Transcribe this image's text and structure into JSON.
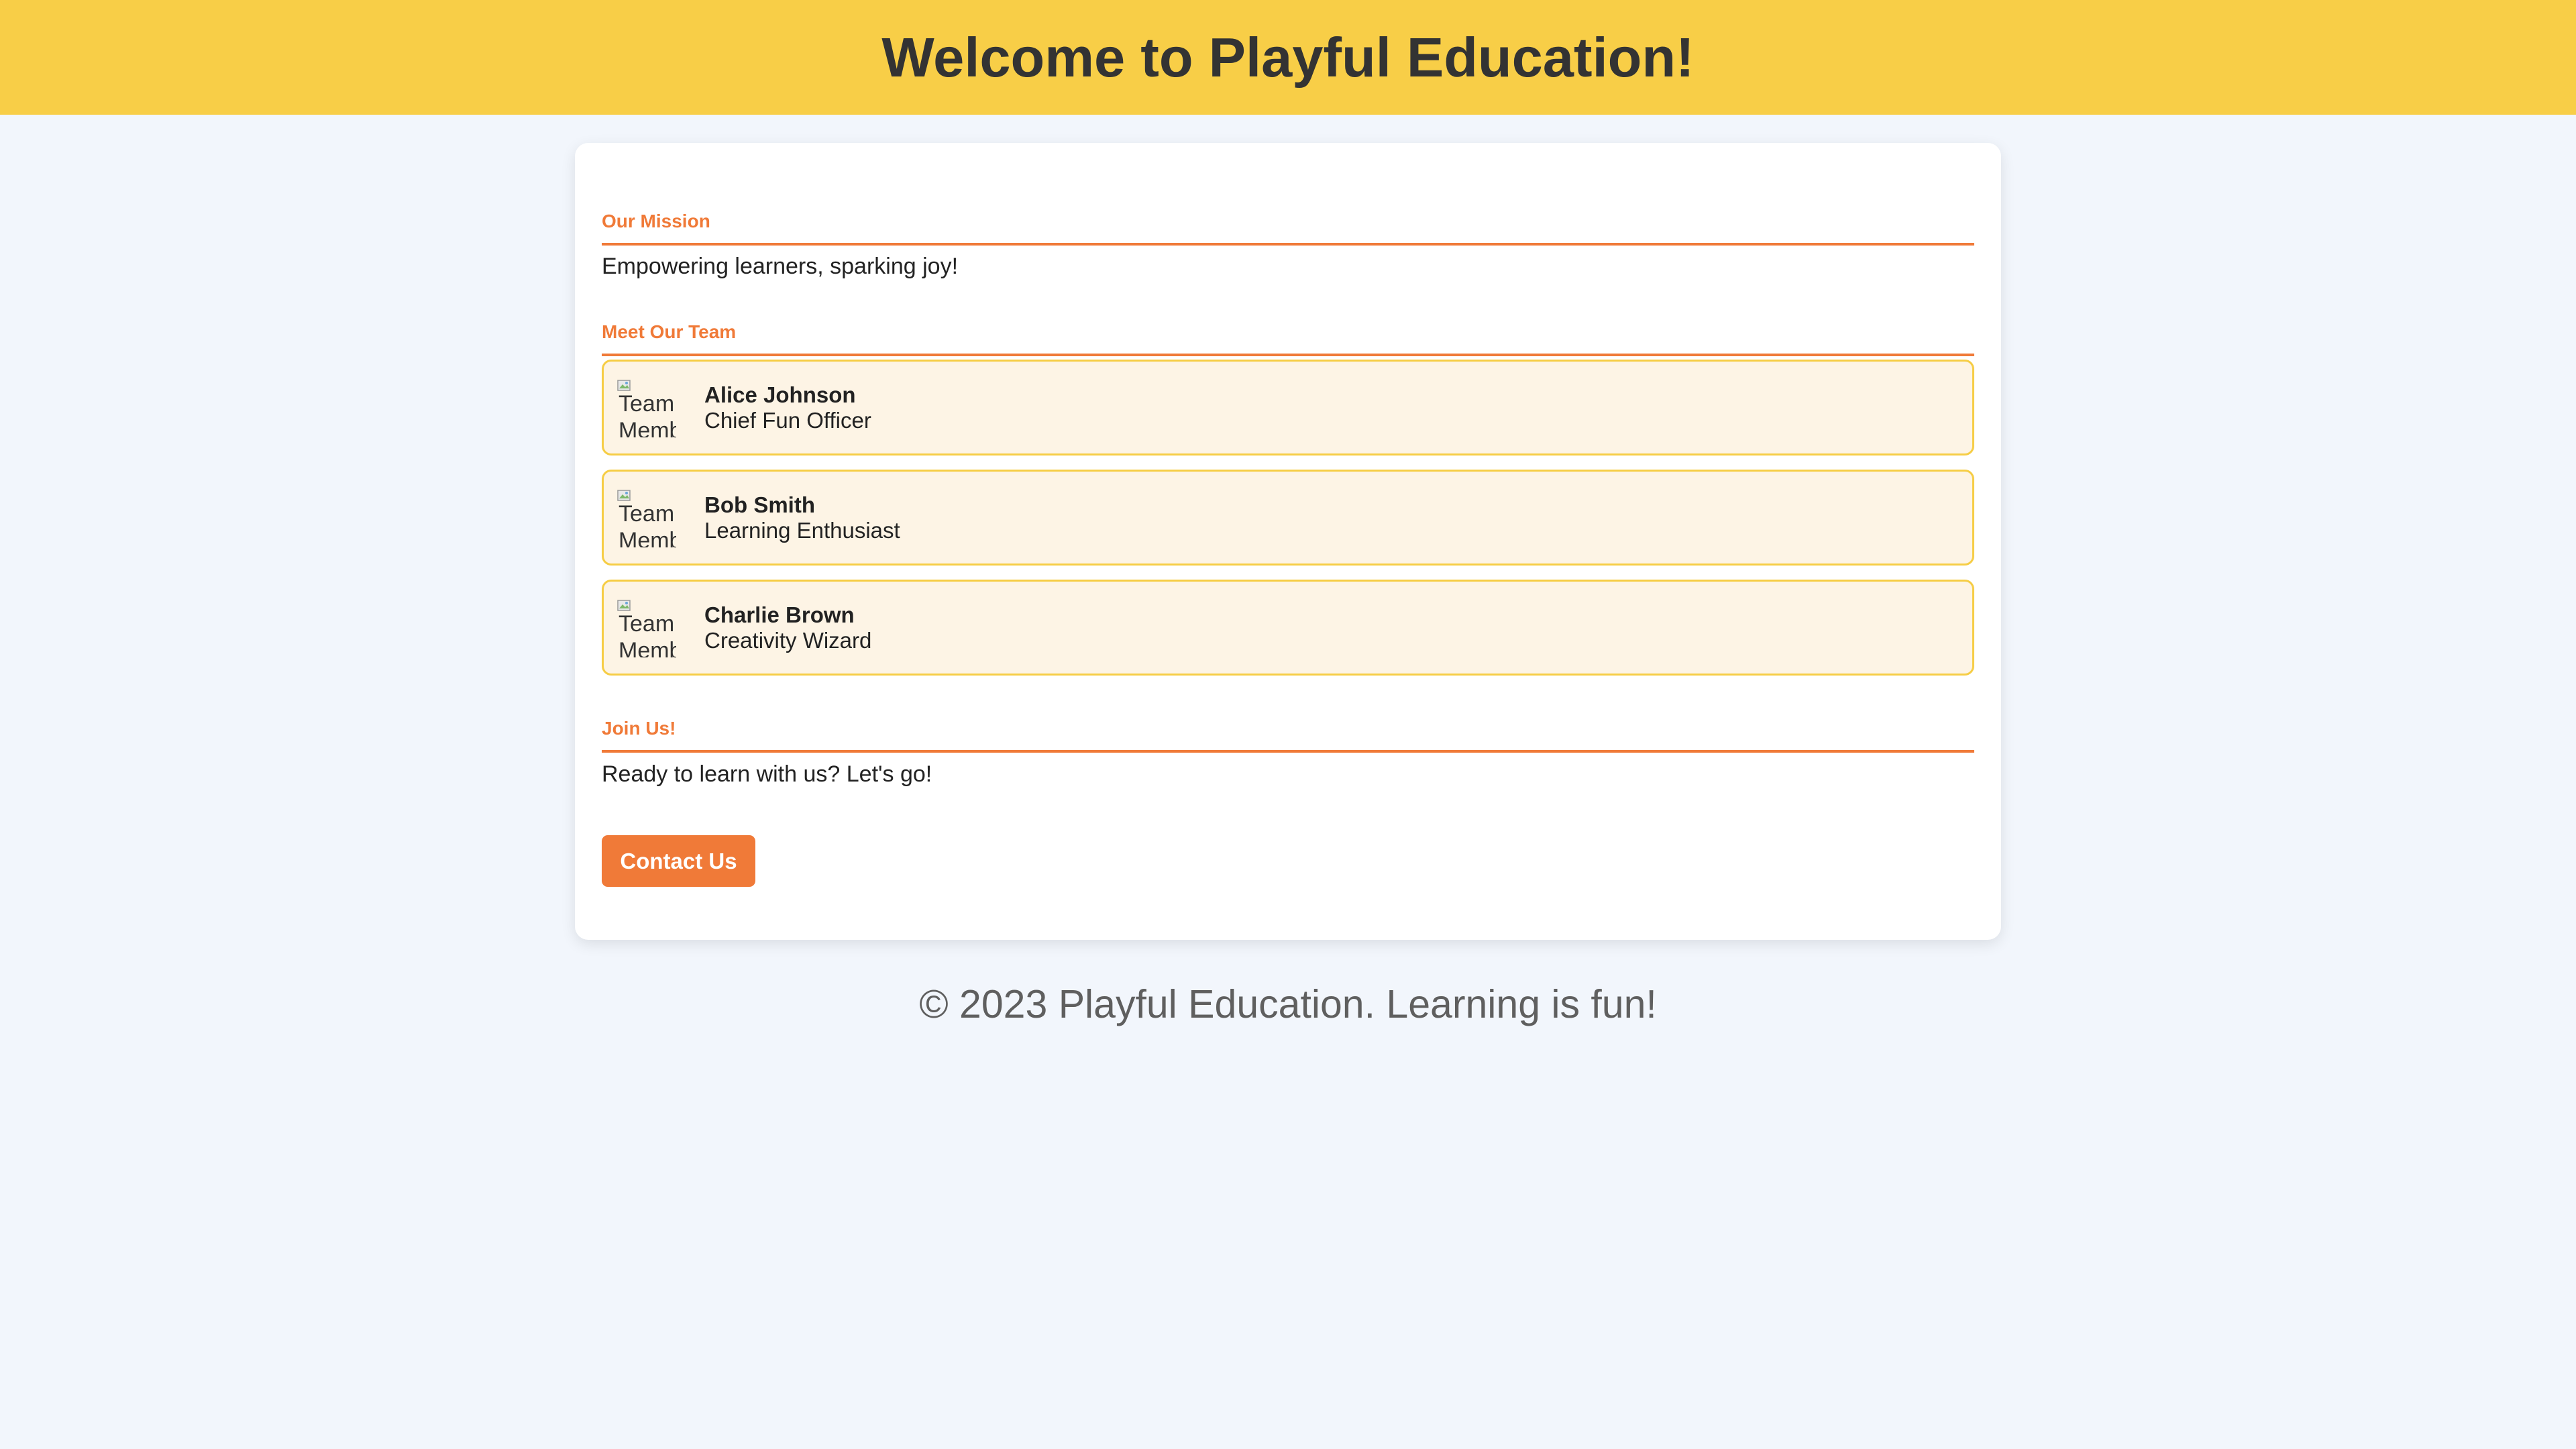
{
  "header": {
    "title": "Welcome to Playful Education!"
  },
  "mission": {
    "heading": "Our Mission",
    "text": "Empowering learners, sparking joy!"
  },
  "team": {
    "heading": "Meet Our Team",
    "members": [
      {
        "name": "Alice Johnson",
        "role": "Chief Fun Officer",
        "image_alt": "Team Member"
      },
      {
        "name": "Bob Smith",
        "role": "Learning Enthusiast",
        "image_alt": "Team Member"
      },
      {
        "name": "Charlie Brown",
        "role": "Creativity Wizard",
        "image_alt": "Team Member"
      }
    ]
  },
  "join": {
    "heading": "Join Us!",
    "text": "Ready to learn with us? Let's go!",
    "button_label": "Contact Us"
  },
  "footer": {
    "text": "© 2023 Playful Education. Learning is fun!"
  },
  "colors": {
    "header_bg": "#f8ce47",
    "accent": "#f07a38",
    "card_item_bg": "#fdf4e5",
    "card_item_border": "#f6cd45",
    "page_bg": "#f2f6fc"
  },
  "icons": {
    "avatar": "broken-image-icon"
  }
}
